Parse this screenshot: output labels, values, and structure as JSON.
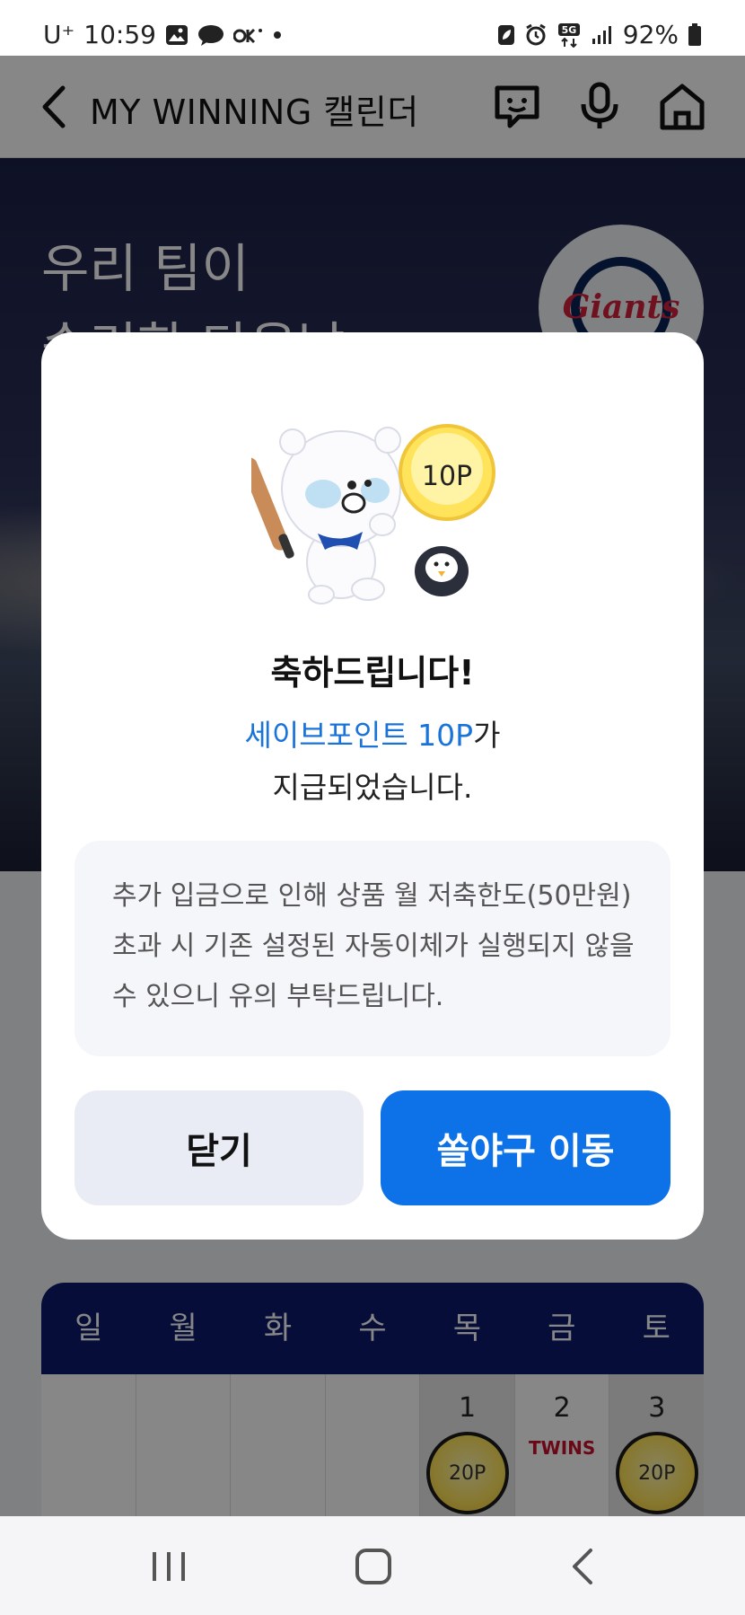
{
  "status_bar": {
    "carrier": "U⁺",
    "time": "10:59",
    "battery": "92%",
    "network": "5G"
  },
  "header": {
    "title": "MY WINNING 캘린더"
  },
  "hero": {
    "line1": "우리 팀이",
    "line2": "승리한 다음날",
    "team_logo_text": "Giants"
  },
  "modal": {
    "coin_label": "10P",
    "heading": "축하드립니다!",
    "message_highlight": "세이브포인트 10P",
    "message_suffix": "가",
    "message_line2": "지급되었습니다.",
    "notice": "추가 입금으로 인해 상품 월 저축한도(50만원)초과 시 기존 설정된 자동이체가 실행되지 않을 수 있으니 유의 부탁드립니다.",
    "close_button": "닫기",
    "go_button": "쏠야구 이동"
  },
  "calendar": {
    "weekdays": [
      "일",
      "월",
      "화",
      "수",
      "목",
      "금",
      "토"
    ],
    "cells": [
      {
        "day": "",
        "reward": ""
      },
      {
        "day": "",
        "reward": ""
      },
      {
        "day": "",
        "reward": ""
      },
      {
        "day": "",
        "reward": ""
      },
      {
        "day": "1",
        "reward": "20P"
      },
      {
        "day": "2",
        "reward": "TWINS"
      },
      {
        "day": "3",
        "reward": "20P"
      }
    ]
  },
  "colors": {
    "accent": "#0d72e8",
    "highlight_text": "#1a73d8",
    "calendar_header": "#0a1a6a"
  }
}
